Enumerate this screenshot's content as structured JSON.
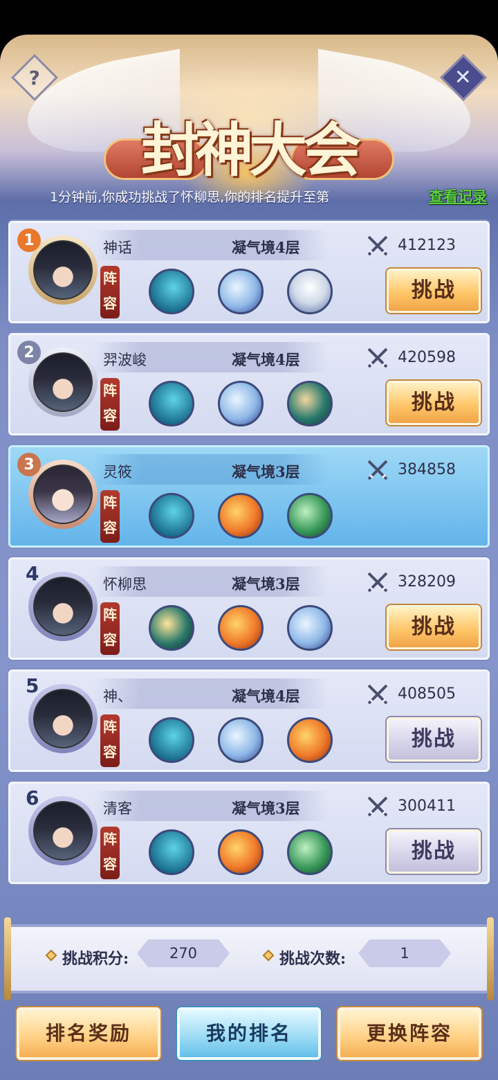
{
  "header": {
    "title": "封神大会",
    "help_icon": "?",
    "close_icon": "✕",
    "notice": "1分钟前,你成功挑战了怀柳思,你的排名提升至第",
    "record_link": "查看记录"
  },
  "lineup_label": "阵容",
  "challenge_label": "挑战",
  "rows": [
    {
      "rank": "1",
      "name": "神话",
      "realm": "凝气境4层",
      "power": "412123",
      "beasts": [
        "whale",
        "ice",
        "tiger"
      ],
      "button": "gold"
    },
    {
      "rank": "2",
      "name": "羿波峻",
      "realm": "凝气境4层",
      "power": "420598",
      "beasts": [
        "whale",
        "ice",
        "teal"
      ],
      "button": "gold"
    },
    {
      "rank": "3",
      "name": "灵筱",
      "realm": "凝气境3层",
      "power": "384858",
      "beasts": [
        "whale",
        "fire",
        "green"
      ],
      "button": "none",
      "is_me": true
    },
    {
      "rank": "4",
      "name": "怀柳思",
      "realm": "凝气境3层",
      "power": "328209",
      "beasts": [
        "jade",
        "fire",
        "ice"
      ],
      "button": "gold"
    },
    {
      "rank": "5",
      "name": "神、",
      "realm": "凝气境4层",
      "power": "408505",
      "beasts": [
        "whale",
        "ice",
        "fire"
      ],
      "button": "grey"
    },
    {
      "rank": "6",
      "name": "清客",
      "realm": "凝气境3层",
      "power": "300411",
      "beasts": [
        "whale",
        "fire",
        "green"
      ],
      "button": "grey"
    }
  ],
  "stats": {
    "points_label": "挑战积分:",
    "points_value": "270",
    "count_label": "挑战次数:",
    "count_value": "1"
  },
  "bottom_buttons": {
    "rewards": "排名奖励",
    "my_rank": "我的排名",
    "change_lineup": "更换阵容"
  },
  "colors": {
    "gold_button": "#ffc76a",
    "selected_row": "#63b4ea",
    "record_link": "#5ad23c"
  }
}
